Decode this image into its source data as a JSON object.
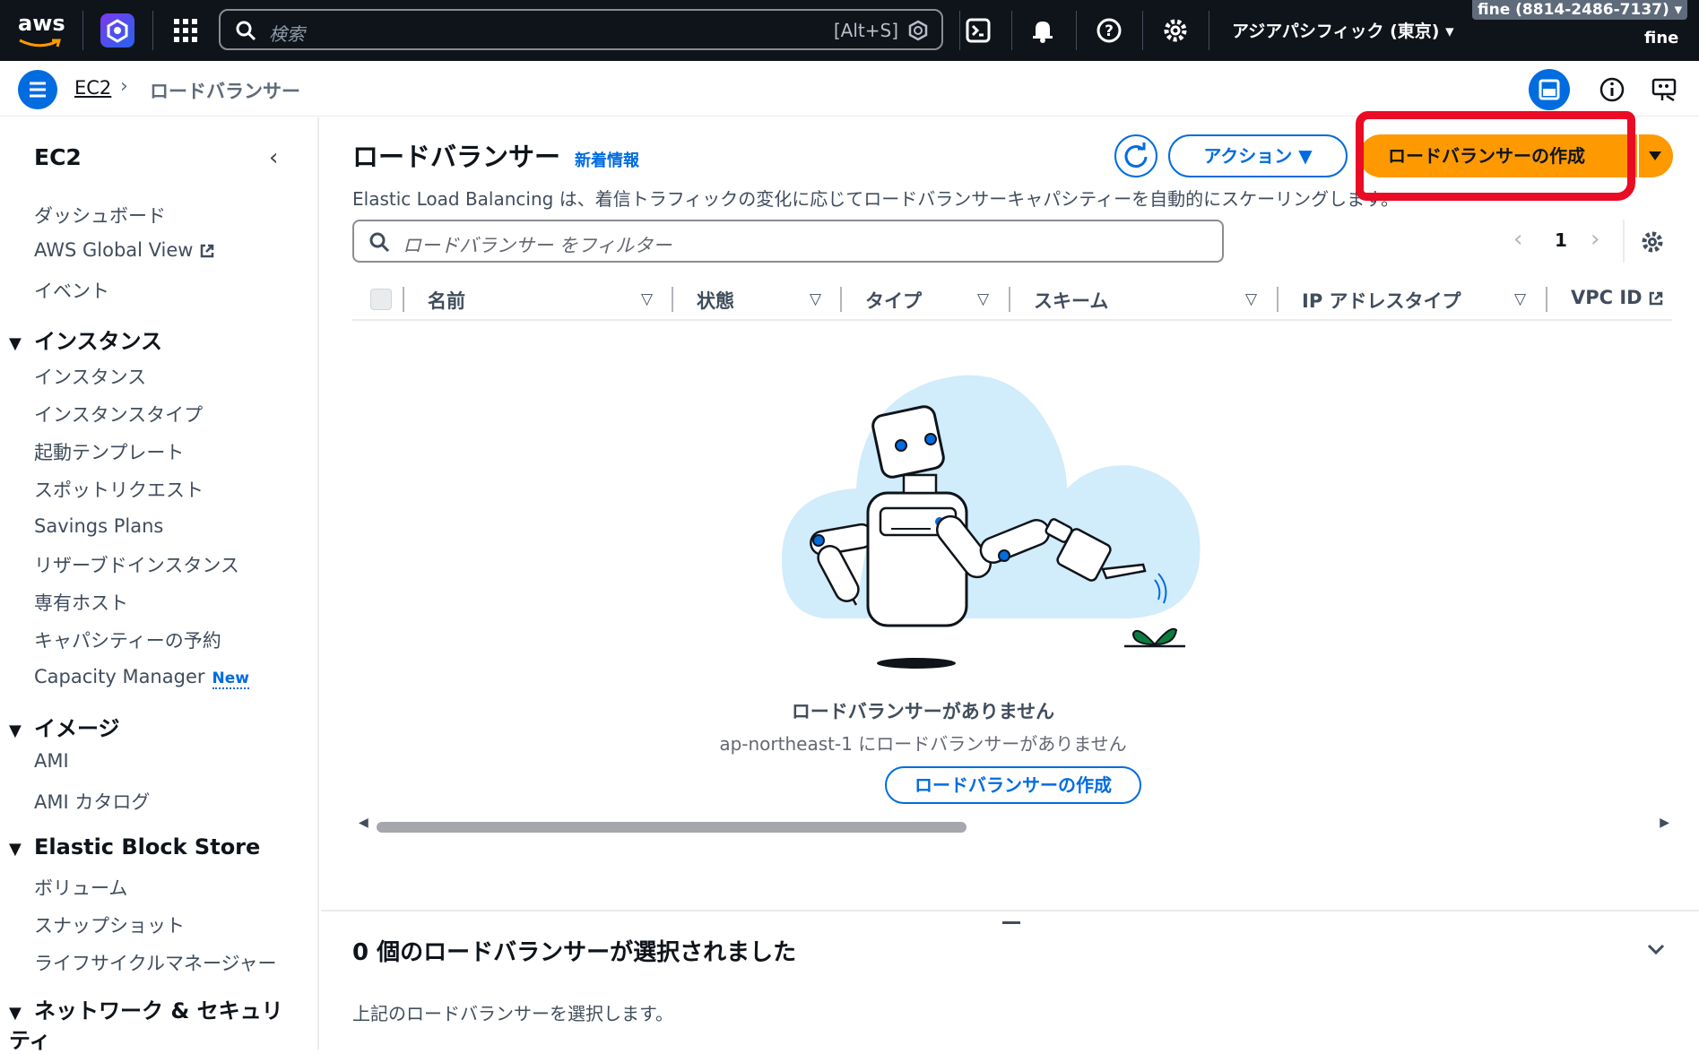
{
  "topbar": {
    "logo": "aws",
    "search_placeholder": "検索",
    "search_shortcut": "[Alt+S]",
    "region": "アジアパシフィック (東京) ▾",
    "account": "fine (8814-2486-7137) ▾",
    "user": "fine",
    "icons": [
      "apps-grid-icon",
      "cloudshell-icon",
      "bell-icon",
      "help-icon",
      "settings-icon"
    ]
  },
  "breadcrumb": {
    "root": "EC2",
    "current": "ロードバランサー"
  },
  "sidebar": {
    "title": "EC2",
    "items_top": [
      "ダッシュボード",
      "AWS Global View",
      "イベント"
    ],
    "sections": [
      {
        "label": "インスタンス",
        "items": [
          "インスタンス",
          "インスタンスタイプ",
          "起動テンプレート",
          "スポットリクエスト",
          "Savings Plans",
          "リザーブドインスタンス",
          "専有ホスト",
          "キャパシティーの予約",
          "Capacity Manager"
        ]
      },
      {
        "label": "イメージ",
        "items": [
          "AMI",
          "AMI カタログ"
        ]
      },
      {
        "label": "Elastic Block Store",
        "items": [
          "ボリューム",
          "スナップショット",
          "ライフサイクルマネージャー"
        ]
      },
      {
        "label": "ネットワーク & セキュリティ",
        "items": []
      }
    ],
    "new_badge": "New"
  },
  "main": {
    "title": "ロードバランサー",
    "info_link": "新着情報",
    "description": "Elastic Load Balancing は、着信トラフィックの変化に応じてロードバランサーキャパシティーを自動的にスケーリングします。",
    "actions_label": "アクション",
    "create_label": "ロードバランサーの作成",
    "filter_placeholder": "ロードバランサー をフィルター",
    "page": "1",
    "columns": [
      "名前",
      "状態",
      "タイプ",
      "スキーム",
      "IP アドレスタイプ",
      "VPC ID"
    ],
    "empty_title": "ロードバランサーがありません",
    "empty_subtitle": "ap-northeast-1 にロードバランサーがありません",
    "empty_button": "ロードバランサーの作成"
  },
  "split_panel": {
    "title": "0 個のロードバランサーが選択されました",
    "description": "上記のロードバランサーを選択します。"
  },
  "colors": {
    "topbar_bg": "#0f141a",
    "primary_blue": "#006ce0",
    "create_orange": "#ff9900",
    "annotation_red": "#ea0b25",
    "cloud_blue": "#d1ecfb"
  }
}
